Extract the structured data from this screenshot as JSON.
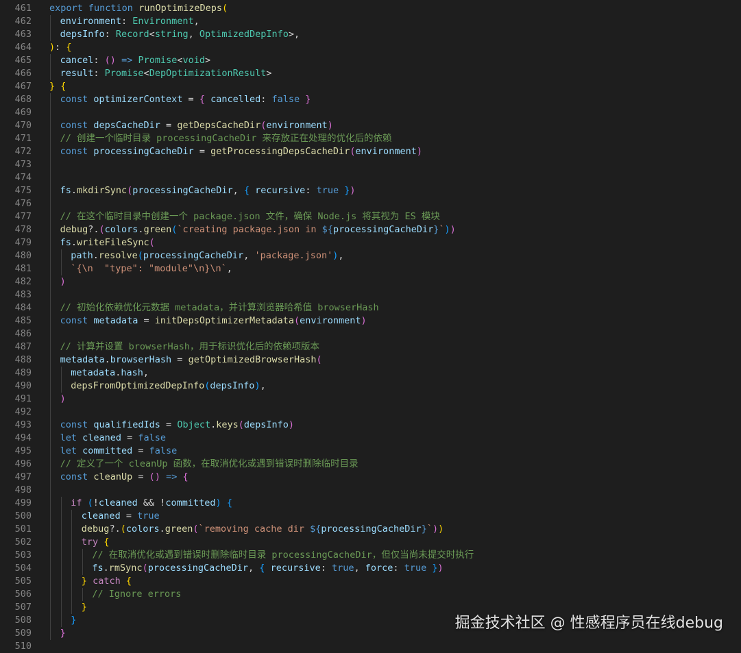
{
  "editor": {
    "colors": {
      "background": "#1e1e1e",
      "line_number": "#858585",
      "default": "#d4d4d4",
      "keyword": "#569cd6",
      "control": "#c586c0",
      "function": "#dcdcaa",
      "variable": "#9cdcfe",
      "type": "#4ec9b0",
      "string": "#ce9178",
      "comment": "#6a9955",
      "bracket1": "#ffd700",
      "bracket2": "#da70d6",
      "bracket3": "#179fff"
    },
    "lines": [
      {
        "n": "461",
        "indent": 0,
        "tokens": [
          [
            "kw",
            "export "
          ],
          [
            "kw",
            "function "
          ],
          [
            "fn",
            "runOptimizeDeps"
          ],
          [
            "b1",
            "("
          ]
        ]
      },
      {
        "n": "462",
        "indent": 1,
        "tokens": [
          [
            "var",
            "environment"
          ],
          [
            "default",
            ": "
          ],
          [
            "type",
            "Environment"
          ],
          [
            "default",
            ","
          ]
        ]
      },
      {
        "n": "463",
        "indent": 1,
        "tokens": [
          [
            "var",
            "depsInfo"
          ],
          [
            "default",
            ": "
          ],
          [
            "type",
            "Record"
          ],
          [
            "default",
            "<"
          ],
          [
            "type",
            "string"
          ],
          [
            "default",
            ", "
          ],
          [
            "type",
            "OptimizedDepInfo"
          ],
          [
            "default",
            ">,"
          ]
        ]
      },
      {
        "n": "464",
        "indent": 0,
        "tokens": [
          [
            "b1",
            ")"
          ],
          [
            "default",
            ": "
          ],
          [
            "b1",
            "{"
          ]
        ]
      },
      {
        "n": "465",
        "indent": 1,
        "tokens": [
          [
            "var",
            "cancel"
          ],
          [
            "default",
            ": "
          ],
          [
            "b2",
            "("
          ],
          [
            "b2",
            ")"
          ],
          [
            "default",
            " "
          ],
          [
            "kw",
            "=>"
          ],
          [
            "default",
            " "
          ],
          [
            "type",
            "Promise"
          ],
          [
            "default",
            "<"
          ],
          [
            "type",
            "void"
          ],
          [
            "default",
            ">"
          ]
        ]
      },
      {
        "n": "466",
        "indent": 1,
        "tokens": [
          [
            "var",
            "result"
          ],
          [
            "default",
            ": "
          ],
          [
            "type",
            "Promise"
          ],
          [
            "default",
            "<"
          ],
          [
            "type",
            "DepOptimizationResult"
          ],
          [
            "default",
            ">"
          ]
        ]
      },
      {
        "n": "467",
        "indent": 0,
        "tokens": [
          [
            "b1",
            "}"
          ],
          [
            "default",
            " "
          ],
          [
            "b1",
            "{"
          ]
        ]
      },
      {
        "n": "468",
        "indent": 1,
        "tokens": [
          [
            "kw",
            "const "
          ],
          [
            "var",
            "optimizerContext"
          ],
          [
            "default",
            " = "
          ],
          [
            "b2",
            "{"
          ],
          [
            "default",
            " "
          ],
          [
            "var",
            "cancelled"
          ],
          [
            "default",
            ": "
          ],
          [
            "kw",
            "false"
          ],
          [
            "default",
            " "
          ],
          [
            "b2",
            "}"
          ]
        ]
      },
      {
        "n": "469",
        "indent": 0,
        "tokens": []
      },
      {
        "n": "470",
        "indent": 1,
        "tokens": [
          [
            "kw",
            "const "
          ],
          [
            "var",
            "depsCacheDir"
          ],
          [
            "default",
            " = "
          ],
          [
            "fn",
            "getDepsCacheDir"
          ],
          [
            "b2",
            "("
          ],
          [
            "var",
            "environment"
          ],
          [
            "b2",
            ")"
          ]
        ]
      },
      {
        "n": "471",
        "indent": 1,
        "tokens": [
          [
            "cmt",
            "// 创建一个临时目录 processingCacheDir 来存放正在处理的优化后的依赖"
          ]
        ]
      },
      {
        "n": "472",
        "indent": 1,
        "tokens": [
          [
            "kw",
            "const "
          ],
          [
            "var",
            "processingCacheDir"
          ],
          [
            "default",
            " = "
          ],
          [
            "fn",
            "getProcessingDepsCacheDir"
          ],
          [
            "b2",
            "("
          ],
          [
            "var",
            "environment"
          ],
          [
            "b2",
            ")"
          ]
        ]
      },
      {
        "n": "473",
        "indent": 0,
        "tokens": []
      },
      {
        "n": "474",
        "indent": 0,
        "tokens": []
      },
      {
        "n": "475",
        "indent": 1,
        "tokens": [
          [
            "var",
            "fs"
          ],
          [
            "default",
            "."
          ],
          [
            "fn",
            "mkdirSync"
          ],
          [
            "b2",
            "("
          ],
          [
            "var",
            "processingCacheDir"
          ],
          [
            "default",
            ", "
          ],
          [
            "b3",
            "{"
          ],
          [
            "default",
            " "
          ],
          [
            "var",
            "recursive"
          ],
          [
            "default",
            ": "
          ],
          [
            "kw",
            "true"
          ],
          [
            "default",
            " "
          ],
          [
            "b3",
            "}"
          ],
          [
            "b2",
            ")"
          ]
        ]
      },
      {
        "n": "476",
        "indent": 0,
        "tokens": []
      },
      {
        "n": "477",
        "indent": 1,
        "tokens": [
          [
            "cmt",
            "// 在这个临时目录中创建一个 package.json 文件，确保 Node.js 将其视为 ES 模块"
          ]
        ]
      },
      {
        "n": "478",
        "indent": 1,
        "tokens": [
          [
            "fn",
            "debug"
          ],
          [
            "default",
            "?."
          ],
          [
            "b2",
            "("
          ],
          [
            "var",
            "colors"
          ],
          [
            "default",
            "."
          ],
          [
            "fn",
            "green"
          ],
          [
            "b3",
            "("
          ],
          [
            "str",
            "`creating package.json in "
          ],
          [
            "kw",
            "${"
          ],
          [
            "var",
            "processingCacheDir"
          ],
          [
            "kw",
            "}"
          ],
          [
            "str",
            "`"
          ],
          [
            "b3",
            ")"
          ],
          [
            "b2",
            ")"
          ]
        ]
      },
      {
        "n": "479",
        "indent": 1,
        "tokens": [
          [
            "var",
            "fs"
          ],
          [
            "default",
            "."
          ],
          [
            "fn",
            "writeFileSync"
          ],
          [
            "b2",
            "("
          ]
        ]
      },
      {
        "n": "480",
        "indent": 2,
        "tokens": [
          [
            "var",
            "path"
          ],
          [
            "default",
            "."
          ],
          [
            "fn",
            "resolve"
          ],
          [
            "b3",
            "("
          ],
          [
            "var",
            "processingCacheDir"
          ],
          [
            "default",
            ", "
          ],
          [
            "str",
            "'package.json'"
          ],
          [
            "b3",
            ")"
          ],
          [
            "default",
            ","
          ]
        ]
      },
      {
        "n": "481",
        "indent": 2,
        "tokens": [
          [
            "str",
            "`{\\n  \"type\": \"module\"\\n}\\n`"
          ],
          [
            "default",
            ","
          ]
        ]
      },
      {
        "n": "482",
        "indent": 1,
        "tokens": [
          [
            "b2",
            ")"
          ]
        ]
      },
      {
        "n": "483",
        "indent": 0,
        "tokens": []
      },
      {
        "n": "484",
        "indent": 1,
        "tokens": [
          [
            "cmt",
            "// 初始化依赖优化元数据 metadata，并计算浏览器哈希值 browserHash"
          ]
        ]
      },
      {
        "n": "485",
        "indent": 1,
        "tokens": [
          [
            "kw",
            "const "
          ],
          [
            "var",
            "metadata"
          ],
          [
            "default",
            " = "
          ],
          [
            "fn",
            "initDepsOptimizerMetadata"
          ],
          [
            "b2",
            "("
          ],
          [
            "var",
            "environment"
          ],
          [
            "b2",
            ")"
          ]
        ]
      },
      {
        "n": "486",
        "indent": 0,
        "tokens": []
      },
      {
        "n": "487",
        "indent": 1,
        "tokens": [
          [
            "cmt",
            "// 计算并设置 browserHash，用于标识优化后的依赖项版本"
          ]
        ]
      },
      {
        "n": "488",
        "indent": 1,
        "tokens": [
          [
            "var",
            "metadata"
          ],
          [
            "default",
            "."
          ],
          [
            "var",
            "browserHash"
          ],
          [
            "default",
            " = "
          ],
          [
            "fn",
            "getOptimizedBrowserHash"
          ],
          [
            "b2",
            "("
          ]
        ]
      },
      {
        "n": "489",
        "indent": 2,
        "tokens": [
          [
            "var",
            "metadata"
          ],
          [
            "default",
            "."
          ],
          [
            "var",
            "hash"
          ],
          [
            "default",
            ","
          ]
        ]
      },
      {
        "n": "490",
        "indent": 2,
        "tokens": [
          [
            "fn",
            "depsFromOptimizedDepInfo"
          ],
          [
            "b3",
            "("
          ],
          [
            "var",
            "depsInfo"
          ],
          [
            "b3",
            ")"
          ],
          [
            "default",
            ","
          ]
        ]
      },
      {
        "n": "491",
        "indent": 1,
        "tokens": [
          [
            "b2",
            ")"
          ]
        ]
      },
      {
        "n": "492",
        "indent": 0,
        "tokens": []
      },
      {
        "n": "493",
        "indent": 1,
        "tokens": [
          [
            "kw",
            "const "
          ],
          [
            "var",
            "qualifiedIds"
          ],
          [
            "default",
            " = "
          ],
          [
            "type",
            "Object"
          ],
          [
            "default",
            "."
          ],
          [
            "fn",
            "keys"
          ],
          [
            "b2",
            "("
          ],
          [
            "var",
            "depsInfo"
          ],
          [
            "b2",
            ")"
          ]
        ]
      },
      {
        "n": "494",
        "indent": 1,
        "tokens": [
          [
            "kw",
            "let "
          ],
          [
            "var",
            "cleaned"
          ],
          [
            "default",
            " = "
          ],
          [
            "kw",
            "false"
          ]
        ]
      },
      {
        "n": "495",
        "indent": 1,
        "tokens": [
          [
            "kw",
            "let "
          ],
          [
            "var",
            "committed"
          ],
          [
            "default",
            " = "
          ],
          [
            "kw",
            "false"
          ]
        ]
      },
      {
        "n": "496",
        "indent": 1,
        "tokens": [
          [
            "cmt",
            "// 定义了一个 cleanUp 函数，在取消优化或遇到错误时删除临时目录"
          ]
        ]
      },
      {
        "n": "497",
        "indent": 1,
        "tokens": [
          [
            "kw",
            "const "
          ],
          [
            "fn",
            "cleanUp"
          ],
          [
            "default",
            " = "
          ],
          [
            "b2",
            "("
          ],
          [
            "b2",
            ")"
          ],
          [
            "default",
            " "
          ],
          [
            "kw",
            "=>"
          ],
          [
            "default",
            " "
          ],
          [
            "b2",
            "{"
          ]
        ]
      },
      {
        "n": "498",
        "indent": 0,
        "tokens": []
      },
      {
        "n": "499",
        "indent": 2,
        "tokens": [
          [
            "ctrl",
            "if "
          ],
          [
            "b3",
            "("
          ],
          [
            "default",
            "!"
          ],
          [
            "var",
            "cleaned"
          ],
          [
            "default",
            " && !"
          ],
          [
            "var",
            "committed"
          ],
          [
            "b3",
            ")"
          ],
          [
            "default",
            " "
          ],
          [
            "b3",
            "{"
          ]
        ]
      },
      {
        "n": "500",
        "indent": 3,
        "tokens": [
          [
            "var",
            "cleaned"
          ],
          [
            "default",
            " = "
          ],
          [
            "kw",
            "true"
          ]
        ]
      },
      {
        "n": "501",
        "indent": 3,
        "tokens": [
          [
            "fn",
            "debug"
          ],
          [
            "default",
            "?."
          ],
          [
            "b1",
            "("
          ],
          [
            "var",
            "colors"
          ],
          [
            "default",
            "."
          ],
          [
            "fn",
            "green"
          ],
          [
            "b2",
            "("
          ],
          [
            "str",
            "`removing cache dir "
          ],
          [
            "kw",
            "${"
          ],
          [
            "var",
            "processingCacheDir"
          ],
          [
            "kw",
            "}"
          ],
          [
            "str",
            "`"
          ],
          [
            "b2",
            ")"
          ],
          [
            "b1",
            ")"
          ]
        ]
      },
      {
        "n": "502",
        "indent": 3,
        "tokens": [
          [
            "ctrl",
            "try "
          ],
          [
            "b1",
            "{"
          ]
        ]
      },
      {
        "n": "503",
        "indent": 4,
        "tokens": [
          [
            "cmt",
            "// 在取消优化或遇到错误时删除临时目录 processingCacheDir，但仅当尚未提交时执行"
          ]
        ]
      },
      {
        "n": "504",
        "indent": 4,
        "tokens": [
          [
            "var",
            "fs"
          ],
          [
            "default",
            "."
          ],
          [
            "fn",
            "rmSync"
          ],
          [
            "b2",
            "("
          ],
          [
            "var",
            "processingCacheDir"
          ],
          [
            "default",
            ", "
          ],
          [
            "b3",
            "{"
          ],
          [
            "default",
            " "
          ],
          [
            "var",
            "recursive"
          ],
          [
            "default",
            ": "
          ],
          [
            "kw",
            "true"
          ],
          [
            "default",
            ", "
          ],
          [
            "var",
            "force"
          ],
          [
            "default",
            ": "
          ],
          [
            "kw",
            "true"
          ],
          [
            "default",
            " "
          ],
          [
            "b3",
            "}"
          ],
          [
            "b2",
            ")"
          ]
        ]
      },
      {
        "n": "505",
        "indent": 3,
        "tokens": [
          [
            "b1",
            "}"
          ],
          [
            "default",
            " "
          ],
          [
            "ctrl",
            "catch "
          ],
          [
            "b1",
            "{"
          ]
        ]
      },
      {
        "n": "506",
        "indent": 4,
        "tokens": [
          [
            "cmt",
            "// Ignore errors"
          ]
        ]
      },
      {
        "n": "507",
        "indent": 3,
        "tokens": [
          [
            "b1",
            "}"
          ]
        ]
      },
      {
        "n": "508",
        "indent": 2,
        "tokens": [
          [
            "b3",
            "}"
          ]
        ]
      },
      {
        "n": "509",
        "indent": 1,
        "tokens": [
          [
            "b2",
            "}"
          ]
        ]
      },
      {
        "n": "510",
        "indent": 0,
        "tokens": []
      }
    ]
  },
  "watermark": {
    "text": "掘金技术社区 @ 性感程序员在线debug"
  }
}
